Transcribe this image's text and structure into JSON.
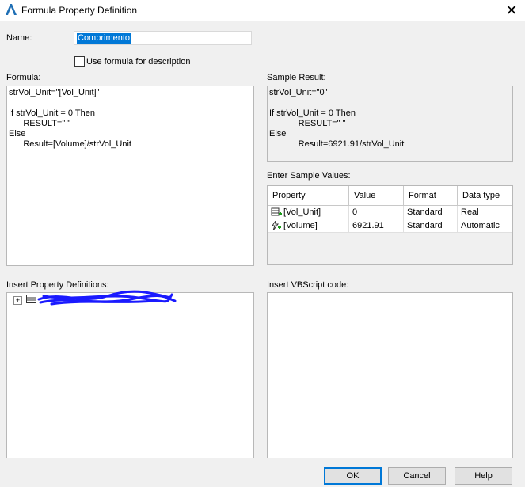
{
  "window": {
    "title": "Formula Property Definition",
    "close_symbol": "✕"
  },
  "name": {
    "label": "Name:",
    "value": "Comprimento"
  },
  "use_formula": {
    "label": "Use formula for description",
    "checked": false
  },
  "formula": {
    "label": "Formula:",
    "lines": [
      "strVol_Unit=\"[Vol_Unit]\"",
      "",
      "If strVol_Unit = 0 Then",
      "      RESULT=\" \"",
      "Else",
      "      Result=[Volume]/strVol_Unit"
    ]
  },
  "sample_result": {
    "label": "Sample Result:",
    "lines": [
      "strVol_Unit=\"0\"",
      "",
      "If strVol_Unit = 0 Then",
      "            RESULT=\" \"",
      "Else",
      "            Result=6921.91/strVol_Unit"
    ]
  },
  "sample_values": {
    "label": "Enter Sample Values:",
    "columns": [
      "Property",
      "Value",
      "Format",
      "Data type"
    ],
    "rows": [
      {
        "icon": "table-property-icon",
        "property": "[Vol_Unit]",
        "value": "0",
        "format": "Standard",
        "data_type": "Real"
      },
      {
        "icon": "automatic-property-icon",
        "property": "[Volume]",
        "value": "6921.91",
        "format": "Standard",
        "data_type": "Automatic"
      }
    ]
  },
  "insert_property": {
    "label": "Insert Property Definitions:",
    "expander": "+"
  },
  "insert_vbscript": {
    "label": "Insert VBScript code:"
  },
  "buttons": {
    "ok": "OK",
    "cancel": "Cancel",
    "help": "Help"
  },
  "colors": {
    "selection": "#0078d7",
    "scribble": "#1a1aff",
    "default_button_border": "#0078d7"
  }
}
